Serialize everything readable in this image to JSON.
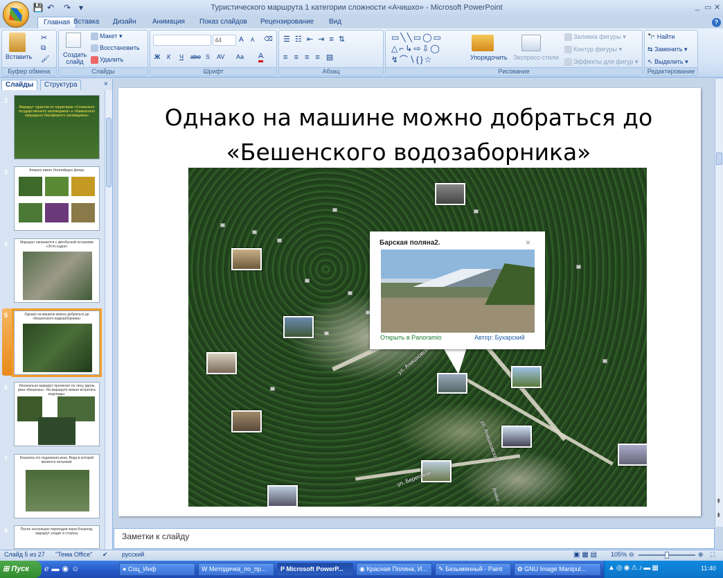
{
  "window": {
    "title": "Туристического маршрута 1 категории сложности «Ачишхо» - Microsoft PowerPoint",
    "controls": [
      "_",
      "▭",
      "✕"
    ]
  },
  "qat": {
    "save_icon": "save-icon",
    "undo_icon": "undo-icon",
    "redo_icon": "redo-icon",
    "customize": "▾"
  },
  "tabs": [
    "Главная",
    "Вставка",
    "Дизайн",
    "Анимация",
    "Показ слайдов",
    "Рецензирование",
    "Вид"
  ],
  "ribbon": {
    "clipboard": {
      "paste": "Вставить",
      "label": "Буфер обмена"
    },
    "slides": {
      "new_slide": "Создать слайд",
      "layout": "Макет",
      "reset": "Восстановить",
      "delete": "Удалить",
      "label": "Слайды"
    },
    "font": {
      "size": "44",
      "bold": "Ж",
      "italic": "К",
      "underline": "Ч",
      "strike": "abe",
      "shadow": "S",
      "spacing": "AV",
      "case": "Aa",
      "color": "A",
      "grow": "A",
      "shrink": "A",
      "label": "Шрифт"
    },
    "paragraph": {
      "label": "Абзац"
    },
    "drawing": {
      "arrange": "Упорядочить",
      "quick_styles": "Экспресс-стили",
      "fill": "Заливка фигуры",
      "outline": "Контур фигуры",
      "effects": "Эффекты для фигур",
      "label": "Рисование"
    },
    "editing": {
      "find": "Найти",
      "replace": "Заменить",
      "select": "Выделить",
      "label": "Редактирование"
    }
  },
  "panel": {
    "tab_slides": "Слайды",
    "tab_outline": "Структура",
    "close": "×"
  },
  "thumbnails": [
    {
      "num": "2",
      "text": "Маршрут туристов по территории «Сочинского государственного заповедника» и «Кавказского природного биосферного заповедника»"
    },
    {
      "num": "3",
      "text": "Ачишхо имеет богатейшую флору"
    },
    {
      "num": "4",
      "text": "Маршрут начинается с автобусной остановки «Эсто-садок»"
    },
    {
      "num": "5",
      "text": "Однако на машине можно добраться до «Бешенского водозаборника»"
    },
    {
      "num": "6",
      "text": "Изначально маршрут пролегает по лесу, вдоль реки «Бешенка». На маршруте можно встретить водопады."
    },
    {
      "num": "7",
      "text": "Бешенка это подземная река. Вода в которой является питьевой."
    },
    {
      "num": "8",
      "text": "После нескольких переходов через Бешенку, маршрут уходит в сторону"
    }
  ],
  "slide": {
    "title": "Однако на машине можно добраться до «Бешенского водозаборника»",
    "popup": {
      "title": "Барская поляна2.",
      "close": "×",
      "open_label": "Открыть в Panoramio",
      "author": "Автор: Бухарский"
    },
    "streets": [
      "ул. Ачишховская",
      "ул. Ачишховская",
      "ул. Береговая",
      "Ачиш..."
    ]
  },
  "notes_placeholder": "Заметки к слайду",
  "status": {
    "slide": "Слайд 5 из 27",
    "theme": "\"Тема Office\"",
    "language": "русский",
    "zoom": "105%"
  },
  "taskbar": {
    "start": "Пуск",
    "tasks": [
      "Соц_Инф",
      "Методичка_по_пр...",
      "Microsoft PowerP...",
      "Красная Поляна, И...",
      "Безымянный - Paint",
      "GNU Image Manipul..."
    ],
    "clock": "11:40"
  },
  "colors": {
    "ribbon_bg": "#d5e4f6",
    "accent": "#15428b",
    "selected_slide": "#f39d2a",
    "taskbar": "#2456c4"
  }
}
